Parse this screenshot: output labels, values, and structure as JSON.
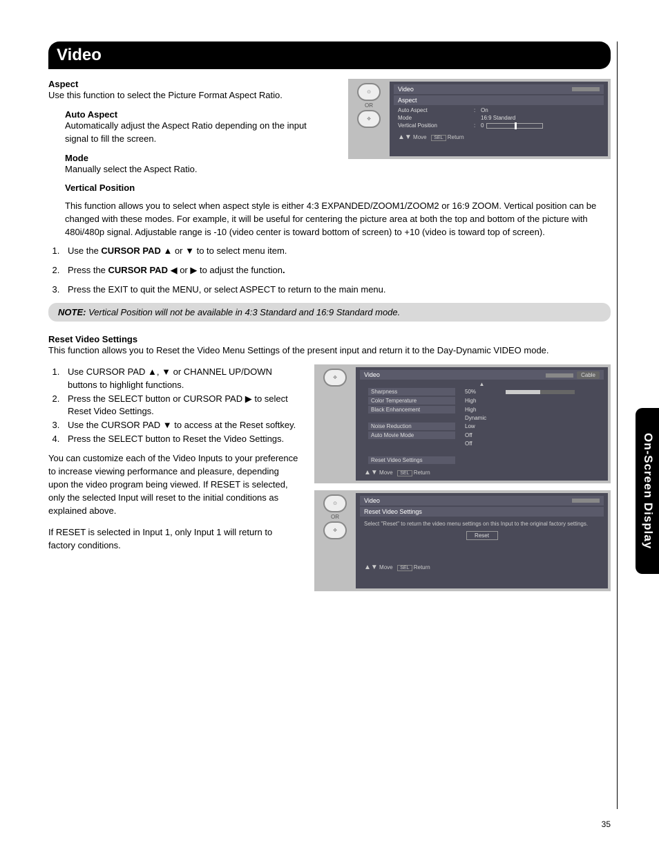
{
  "title": "Video",
  "side_tab": "On-Screen Display",
  "page_number": "35",
  "sections": {
    "aspect": {
      "heading": "Aspect",
      "body": "Use this function to select the Picture Format Aspect Ratio.",
      "auto": {
        "heading": "Auto Aspect",
        "body": "Automatically adjust the Aspect Ratio depending on the input signal to fill the screen."
      },
      "mode": {
        "heading": "Mode",
        "body": "Manually select the Aspect Ratio."
      },
      "vpos": {
        "heading": "Vertical Position",
        "body": "This function allows you to select when aspect style is either 4:3 EXPANDED/ZOOM1/ZOOM2 or 16:9 ZOOM.  Vertical position can be changed with these modes.  For example, it will be useful for centering the picture area at both the top and bottom of the picture with 480i/480p signal.  Adjustable range is -10 (video center is toward bottom of screen) to +10 (video is toward top of screen)."
      }
    },
    "steps_aspect": {
      "s1a": "Use the ",
      "s1b": "CURSOR PAD",
      "s1c": " ▲ or ▼ to to select menu item.",
      "s2a": "Press the ",
      "s2b": "CURSOR PAD",
      "s2c": " ◀ or ▶ to adjust the function",
      "s2d": ".",
      "s3": "Press the EXIT to quit the MENU, or select ASPECT to return to the main menu."
    },
    "note": {
      "label": "NOTE:",
      "text": "  Vertical Position will not be available in 4:3 Standard and 16:9 Standard mode."
    },
    "reset": {
      "heading": "Reset Video Settings",
      "body": "This function allows you to Reset the Video Menu Settings of the present input and return it to the Day-Dynamic VIDEO mode.",
      "steps": {
        "s1": "Use CURSOR PAD ▲, ▼ or CHANNEL UP/DOWN buttons to highlight functions.",
        "s2": "Press the SELECT button or CURSOR PAD ▶ to select Reset Video Settings.",
        "s3": "Use the CURSOR PAD ▼ to access at the Reset softkey.",
        "s4": "Press the SELECT button to Reset the Video Settings."
      },
      "para1": "You can customize each of the Video Inputs to your preference to increase viewing performance and pleasure, depending upon the video program being viewed. If RESET is selected, only the selected Input will reset to the initial conditions as explained above.",
      "para2": "If RESET is selected in Input 1, only Input 1 will return to factory conditions."
    }
  },
  "osd1": {
    "or": "OR",
    "title": "Video",
    "sub": "Aspect",
    "rows": {
      "r1": {
        "label": "Auto Aspect",
        "val": "On"
      },
      "r2": {
        "label": "Mode",
        "val": "16:9 Standard"
      },
      "r3": {
        "label": "Vertical Position",
        "val": "0"
      }
    },
    "foot_move": "Move",
    "foot_sel": "SEL",
    "foot_return": "Return"
  },
  "osd2": {
    "title": "Video",
    "cable": "Cable",
    "items": {
      "i1": {
        "name": "Sharpness",
        "val": "50%"
      },
      "i2": {
        "name": "Color Temperature",
        "val": "High"
      },
      "i3": {
        "name": "Black Enhancement",
        "val": "High"
      },
      "i4": {
        "name": "",
        "val": "Dynamic"
      },
      "i5": {
        "name": "Noise Reduction",
        "val": "Low"
      },
      "i6": {
        "name": "Auto Movie Mode",
        "val": "Off"
      },
      "i7": {
        "name": "",
        "val": "Off"
      },
      "i8": {
        "name": "Reset Video Settings",
        "val": ""
      }
    },
    "foot_move": "Move",
    "foot_sel": "SEL",
    "foot_return": "Return"
  },
  "osd3": {
    "or": "OR",
    "title": "Video",
    "sub": "Reset Video Settings",
    "msg": "Select \"Reset\" to return the video menu settings on this Input to the original factory settings.",
    "reset_btn": "Reset",
    "foot_move": "Move",
    "foot_sel": "SEL",
    "foot_return": "Return"
  }
}
